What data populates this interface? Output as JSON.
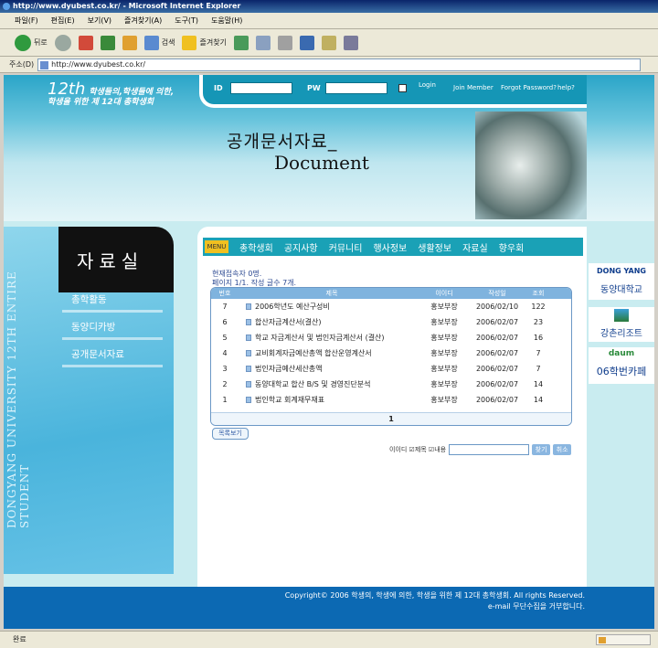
{
  "browser": {
    "title": "http://www.dyubest.co.kr/ - Microsoft Internet Explorer",
    "menu": [
      "파일(F)",
      "편집(E)",
      "보기(V)",
      "즐겨찾기(A)",
      "도구(T)",
      "도움말(H)"
    ],
    "toolbar": {
      "back": "뒤로",
      "search": "검색",
      "favorites": "즐겨찾기"
    },
    "address_label": "주소(D)",
    "address": "http://www.dyubest.co.kr/",
    "status": "완료"
  },
  "site": {
    "logo_number": "12th",
    "logo_line1": "학생들의,학생들에 의한,",
    "logo_line2": "학생을 위한 제 12대 총학생회",
    "login": {
      "id_label": "ID",
      "pw_label": "PW",
      "login_label": "Login",
      "join_label": "Join Member",
      "forgot_label": "Forgot Password?",
      "help_label": "help?"
    },
    "page_title_kr": "공개문서자료_",
    "page_title_en": "Document",
    "section_title": "자료실",
    "vertical_text": "DONGYANG UNIVERSITY 12TH ENTIRE STUDENT",
    "side_menu": [
      "총학활동",
      "동양디카방",
      "공개문서자료"
    ],
    "nav": {
      "menu_label": "MENU",
      "items": [
        "총학생회",
        "공지사항",
        "커뮤니티",
        "행사정보",
        "생활정보",
        "자료실",
        "향우회"
      ]
    },
    "board": {
      "online": "현재접속자 0명.",
      "page_info": "페이지 1/1. 작성 글수 7개.",
      "headers": [
        "번호",
        "제목",
        "이이디",
        "작성일",
        "조회"
      ],
      "rows": [
        {
          "no": "7",
          "title": "2006학년도 예산구성비",
          "author": "홍보부장",
          "date": "2006/02/10",
          "views": "122"
        },
        {
          "no": "6",
          "title": "합산자금계산서(결산)",
          "author": "홍보부장",
          "date": "2006/02/07",
          "views": "23"
        },
        {
          "no": "5",
          "title": "학교 자금계산서 및 법인자금계산서 (결산)",
          "author": "홍보부장",
          "date": "2006/02/07",
          "views": "16"
        },
        {
          "no": "4",
          "title": "교비회계자금예산총액 합산운영계산서",
          "author": "홍보부장",
          "date": "2006/02/07",
          "views": "7"
        },
        {
          "no": "3",
          "title": "법인자금예산세산총액",
          "author": "홍보부장",
          "date": "2006/02/07",
          "views": "7"
        },
        {
          "no": "2",
          "title": "동양대학교 합산 B/S 및 경영진단분석",
          "author": "홍보부장",
          "date": "2006/02/07",
          "views": "14"
        },
        {
          "no": "1",
          "title": "법인학교 회계재무재표",
          "author": "홍보부장",
          "date": "2006/02/07",
          "views": "14"
        }
      ],
      "page": "1",
      "list_button": "목록보기",
      "search_label": "이이디 ☑제목 ☑내용",
      "search_button": "찾기",
      "cancel_button": "취소"
    },
    "banners": {
      "dongyang_top": "DONG YANG",
      "dongyang_bottom": "동양대학교",
      "gangchon": "강촌리조트",
      "cafe_top": "daum",
      "cafe_bottom": "06학번카페"
    },
    "footer": {
      "line1": "Copyright© 2006 학생의, 학생에 의한, 학생을 위한 제 12대 총학생회. All rights Reserved.",
      "line2": "e-mail 무단수집을 거부합니다."
    }
  },
  "colors": {
    "accent": "#1596b6",
    "nav": "#1aa1b6",
    "footer": "#0c69b3",
    "board_header": "#7fb3de"
  }
}
